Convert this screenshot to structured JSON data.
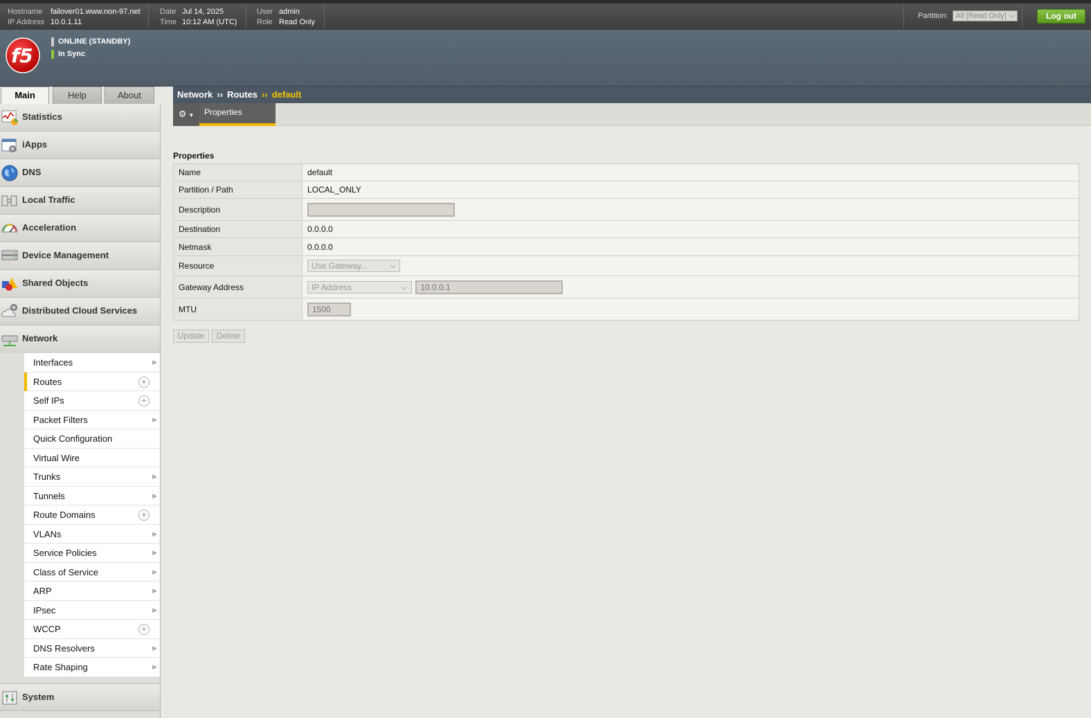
{
  "header": {
    "hostname_label": "Hostname",
    "hostname": "failover01.www.non-97.net",
    "ip_label": "IP Address",
    "ip": "10.0.1.11",
    "date_label": "Date",
    "date": "Jul 14, 2025",
    "time_label": "Time",
    "time": "10:12 AM (UTC)",
    "user_label": "User",
    "user": "admin",
    "role_label": "Role",
    "role": "Read Only",
    "partition_label": "Partition:",
    "partition_value": "All [Read Only]",
    "logout_label": "Log out"
  },
  "status": {
    "online": "ONLINE (STANDBY)",
    "sync": "In Sync",
    "online_color": "#cfcfcf",
    "sync_color": "#8cc63f"
  },
  "tabs": [
    {
      "label": "Main"
    },
    {
      "label": "Help"
    },
    {
      "label": "About"
    }
  ],
  "breadcrumb": {
    "items": [
      "Network",
      "Routes",
      "default"
    ],
    "separator": "››"
  },
  "sidebar": {
    "sections": [
      {
        "label": "Statistics",
        "icon": "statistics-icon"
      },
      {
        "label": "iApps",
        "icon": "iapps-icon"
      },
      {
        "label": "DNS",
        "icon": "globe-icon"
      },
      {
        "label": "Local Traffic",
        "icon": "local-traffic-icon"
      },
      {
        "label": "Acceleration",
        "icon": "gauge-icon"
      },
      {
        "label": "Device Management",
        "icon": "device-icon"
      },
      {
        "label": "Shared Objects",
        "icon": "shapes-icon"
      },
      {
        "label": "Distributed Cloud Services",
        "icon": "cloud-gear-icon"
      },
      {
        "label": "Network",
        "icon": "network-icon"
      }
    ],
    "network_items": [
      {
        "label": "Interfaces",
        "marker": "arrow"
      },
      {
        "label": "Routes",
        "marker": "plus"
      },
      {
        "label": "Self IPs",
        "marker": "plus"
      },
      {
        "label": "Packet Filters",
        "marker": "arrow"
      },
      {
        "label": "Quick Configuration",
        "marker": "none"
      },
      {
        "label": "Virtual Wire",
        "marker": "none"
      },
      {
        "label": "Trunks",
        "marker": "arrow"
      },
      {
        "label": "Tunnels",
        "marker": "arrow"
      },
      {
        "label": "Route Domains",
        "marker": "plus"
      },
      {
        "label": "VLANs",
        "marker": "arrow"
      },
      {
        "label": "Service Policies",
        "marker": "arrow"
      },
      {
        "label": "Class of Service",
        "marker": "arrow"
      },
      {
        "label": "ARP",
        "marker": "arrow"
      },
      {
        "label": "IPsec",
        "marker": "arrow"
      },
      {
        "label": "WCCP",
        "marker": "plus"
      },
      {
        "label": "DNS Resolvers",
        "marker": "arrow"
      },
      {
        "label": "Rate Shaping",
        "marker": "arrow"
      }
    ],
    "system": {
      "label": "System",
      "icon": "system-icon"
    }
  },
  "toolbar": {
    "properties_tab": "Properties"
  },
  "properties": {
    "title": "Properties",
    "name_label": "Name",
    "name": "default",
    "partition_label": "Partition / Path",
    "partition": "LOCAL_ONLY",
    "description_label": "Description",
    "description": "",
    "destination_label": "Destination",
    "destination": "0.0.0.0",
    "netmask_label": "Netmask",
    "netmask": "0.0.0.0",
    "resource_label": "Resource",
    "resource": "Use Gateway...",
    "gateway_label": "Gateway Address",
    "gateway_type": "IP Address",
    "gateway": "10.0.0.1",
    "mtu_label": "MTU",
    "mtu": "1500"
  },
  "actions": {
    "update": "Update",
    "delete": "Delete"
  },
  "colors": {
    "accent": "#f5b800",
    "logout_green": "#6aab24"
  }
}
